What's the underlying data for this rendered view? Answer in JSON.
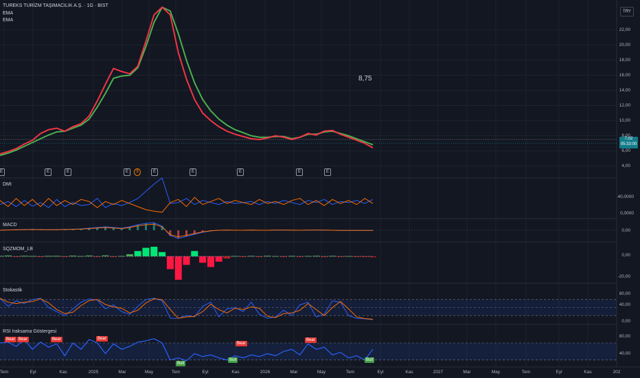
{
  "header": {
    "symbol_title": "TUREKS TURİZM TAŞIMACILIK A.Ş. · 1G · BIST",
    "ema1_label": "EMA",
    "ema2_label": "EMA",
    "currency": "TRY",
    "annotation": "8,75",
    "last_price": "7,02",
    "countdown": "05:33:00"
  },
  "events": [
    "E",
    "E",
    "E",
    "E",
    "$",
    "E",
    "E",
    "E",
    "E",
    "E"
  ],
  "panes": {
    "dmi": {
      "title": "DMI",
      "ticks": [
        "40,0000",
        "0,0000"
      ]
    },
    "macd": {
      "title": "MACD",
      "ticks": [
        "0,00"
      ]
    },
    "sqz": {
      "title": "SQZMOM_LB",
      "ticks": [
        "0,00",
        "-20,00"
      ]
    },
    "stoch": {
      "title": "Stokastik",
      "ticks": [
        "80,00",
        "40,00",
        "0,00"
      ]
    },
    "rsi": {
      "title": "RSI Iraksama Göstergesi",
      "ticks": [
        "80,00",
        "40,00"
      ]
    }
  },
  "rsi_badges": [
    {
      "text": "Bear",
      "kind": "bear"
    },
    {
      "text": "Bear",
      "kind": "bear"
    },
    {
      "text": "Bear",
      "kind": "bear"
    },
    {
      "text": "Bear",
      "kind": "bear"
    },
    {
      "text": "Bear",
      "kind": "bear"
    },
    {
      "text": "Bear",
      "kind": "bear"
    },
    {
      "text": "Bull",
      "kind": "bull"
    },
    {
      "text": "Bull",
      "kind": "bull"
    },
    {
      "text": "Bull",
      "kind": "bull"
    }
  ],
  "chart_data": {
    "type": "line",
    "title": "TUREKS TURİZM TAŞIMACILIK A.Ş. · 1G · BIST",
    "price_axis_ticks": [
      22,
      20,
      18,
      16,
      14,
      12,
      10,
      8,
      6,
      4
    ],
    "price_axis_tick_labels": [
      "22,00",
      "20,00",
      "18,00",
      "16,00",
      "14,00",
      "12,00",
      "10,00",
      "8,00",
      "6,00",
      "4,00"
    ],
    "x_tick_labels": [
      "Tem",
      "Eyl",
      "Kas",
      "2025",
      "Mar",
      "May",
      "Tem",
      "Eyl",
      "Kas",
      "2026",
      "Mar",
      "May",
      "Tem",
      "Eyl",
      "Kas",
      "2027",
      "Mar",
      "May",
      "Tem",
      "Eyl",
      "Kas",
      "202"
    ],
    "grid": true,
    "series": [
      {
        "name": "EMA",
        "color": "#f23645",
        "values": [
          5.6,
          5.9,
          6.3,
          6.9,
          7.4,
          8.3,
          8.8,
          9.0,
          8.6,
          9.2,
          9.6,
          10.6,
          12.6,
          14.8,
          16.9,
          16.5,
          16.2,
          17.2,
          20.5,
          24.0,
          25.0,
          24.0,
          19.0,
          15.5,
          12.8,
          11.0,
          10.0,
          9.2,
          8.6,
          8.2,
          7.9,
          7.6,
          7.5,
          7.7,
          8.0,
          7.8,
          7.5,
          7.8,
          8.3,
          8.1,
          8.6,
          8.7,
          8.2,
          7.8,
          7.4,
          7.0,
          6.4
        ]
      },
      {
        "name": "EMA",
        "color": "#4caf50",
        "values": [
          5.4,
          5.7,
          6.1,
          6.6,
          7.1,
          7.6,
          8.1,
          8.5,
          8.6,
          9.0,
          9.4,
          10.2,
          11.8,
          13.6,
          15.6,
          15.9,
          16.0,
          17.0,
          19.8,
          23.0,
          25.0,
          24.5,
          21.5,
          18.0,
          15.0,
          12.8,
          11.3,
          10.2,
          9.4,
          8.8,
          8.4,
          8.0,
          7.8,
          7.8,
          7.9,
          7.9,
          7.6,
          7.8,
          8.2,
          8.2,
          8.5,
          8.6,
          8.3,
          8.0,
          7.6,
          7.2,
          6.8
        ]
      }
    ],
    "dmi_range": [
      0,
      70
    ],
    "dmi_plus": [
      18,
      24,
      14,
      26,
      15,
      22,
      12,
      28,
      14,
      22,
      16,
      18,
      30,
      12,
      20,
      16,
      22,
      30,
      44,
      58,
      70,
      20,
      22,
      30,
      18,
      26,
      22,
      18,
      24,
      20,
      22,
      24,
      18,
      24,
      20,
      26,
      22,
      18,
      26,
      22,
      28,
      18,
      24,
      22,
      26,
      20,
      28
    ],
    "dmi_minus": [
      26,
      14,
      30,
      16,
      28,
      14,
      30,
      16,
      26,
      18,
      28,
      24,
      12,
      24,
      18,
      26,
      20,
      14,
      8,
      5,
      3,
      22,
      28,
      14,
      32,
      18,
      24,
      30,
      20,
      26,
      22,
      18,
      28,
      20,
      24,
      18,
      26,
      30,
      18,
      26,
      16,
      28,
      20,
      26,
      18,
      30,
      20
    ],
    "macd_range": [
      -1.5,
      1.5
    ],
    "macd": [
      0,
      0.05,
      0.08,
      0.1,
      0.12,
      0.1,
      0.08,
      0.1,
      0.12,
      0.15,
      0.2,
      0.3,
      0.4,
      0.5,
      0.4,
      0.3,
      0.5,
      0.8,
      1.0,
      1.1,
      0.6,
      -0.8,
      -1.2,
      -0.9,
      -0.6,
      -0.3,
      -0.1,
      0,
      0.02,
      0,
      0,
      0.02,
      0,
      0,
      0.02,
      0.03,
      0.01,
      0,
      0.02,
      0.03,
      0.02,
      0,
      -0.02,
      -0.03,
      -0.02,
      -0.03,
      -0.02
    ],
    "sqz_range": [
      -25,
      12
    ],
    "sqz": [
      0.5,
      0.8,
      -0.5,
      0.6,
      0.4,
      -0.4,
      0.5,
      0.5,
      -0.6,
      0.7,
      0.3,
      0.8,
      -0.5,
      0.9,
      -0.6,
      0.4,
      2,
      5,
      8,
      9,
      4,
      -12,
      -22,
      -8,
      5,
      -6,
      -10,
      -5,
      -2,
      0.4,
      -0.6,
      0.5,
      -0.5,
      0.6,
      0.3,
      -0.4,
      0.5,
      -0.6,
      0.4,
      0.6,
      -0.7,
      0.5,
      -0.4,
      0.3,
      -0.6,
      -0.5,
      -0.8
    ],
    "stoch_range": [
      0,
      100
    ],
    "stoch_levels": [
      80,
      50,
      20
    ],
    "stoch": [
      85,
      55,
      75,
      65,
      80,
      85,
      50,
      35,
      20,
      45,
      70,
      82,
      78,
      45,
      60,
      35,
      25,
      55,
      80,
      85,
      75,
      10,
      10,
      20,
      15,
      55,
      70,
      15,
      45,
      50,
      35,
      70,
      25,
      10,
      15,
      40,
      20,
      60,
      70,
      15,
      25,
      75,
      70,
      20,
      10,
      8,
      5
    ],
    "rsi_range": [
      20,
      100
    ],
    "rsi_levels": [
      70,
      30
    ],
    "rsi": [
      70,
      72,
      62,
      78,
      55,
      72,
      60,
      68,
      40,
      70,
      55,
      78,
      70,
      45,
      68,
      55,
      62,
      72,
      75,
      80,
      70,
      30,
      35,
      28,
      45,
      38,
      42,
      35,
      30,
      40,
      35,
      42,
      38,
      45,
      40,
      50,
      55,
      42,
      68,
      55,
      60,
      42,
      48,
      35,
      40,
      30,
      55
    ]
  }
}
